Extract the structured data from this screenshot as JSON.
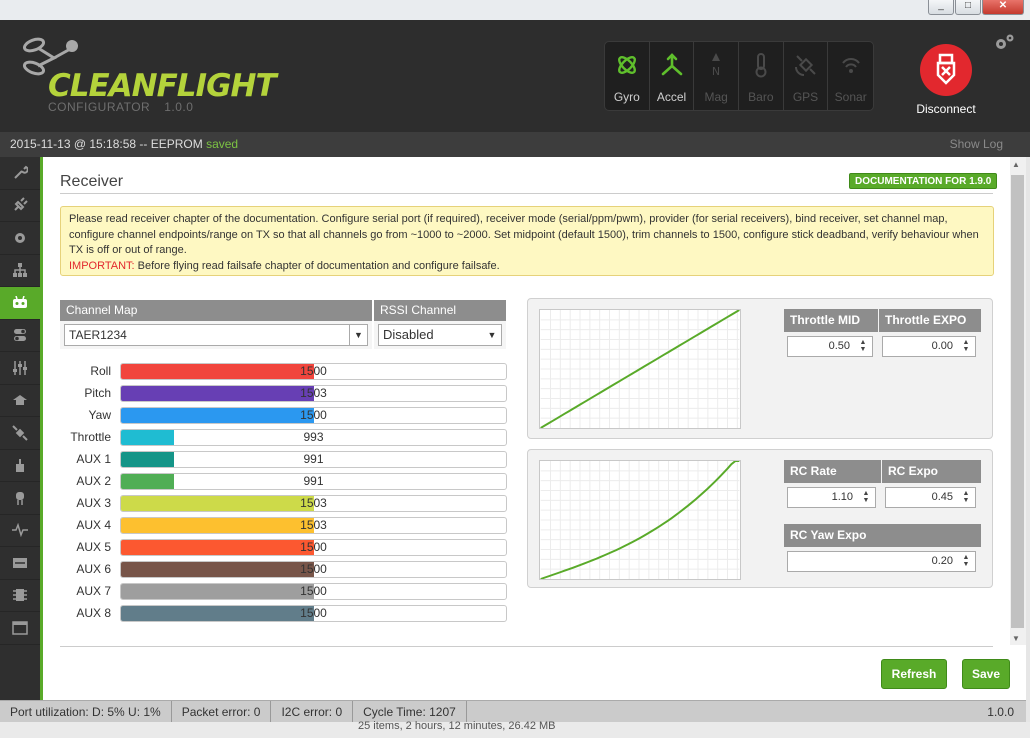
{
  "window": {
    "minimize": "_",
    "maximize": "□",
    "close": "✕"
  },
  "header": {
    "logo_text": "CLEANFLIGHT",
    "logo_sub": "CONFIGURATOR",
    "logo_version": "1.0.0",
    "disconnect_label": "Disconnect"
  },
  "sensors": [
    {
      "label": "Gyro",
      "active": true
    },
    {
      "label": "Accel",
      "active": true
    },
    {
      "label": "Mag",
      "active": false
    },
    {
      "label": "Baro",
      "active": false
    },
    {
      "label": "GPS",
      "active": false
    },
    {
      "label": "Sonar",
      "active": false
    }
  ],
  "log": {
    "prefix": "2015-11-13 @ 15:18:58 -- EEPROM ",
    "saved": "saved",
    "show_log": "Show Log"
  },
  "receiver": {
    "title": "Receiver",
    "doc_button": "DOCUMENTATION FOR 1.9.0",
    "note": "Please read receiver chapter of the documentation. Configure serial port (if required), receiver mode (serial/ppm/pwm), provider (for serial receivers), bind receiver, set channel map, configure channel endpoints/range on TX so that all channels go from ~1000 to ~2000. Set midpoint (default 1500), trim channels to 1500, configure stick deadband, verify behaviour when TX is off or out of range.",
    "note_important_label": "IMPORTANT:",
    "note_important_text": " Before flying read failsafe chapter of documentation and configure failsafe.",
    "channel_map_header": "Channel Map",
    "channel_map_value": "TAER1234",
    "rssi_header": "RSSI Channel",
    "rssi_value": "Disabled",
    "channels": [
      {
        "name": "Roll",
        "value": 1500,
        "color": "#f1453d"
      },
      {
        "name": "Pitch",
        "value": 1503,
        "color": "#673fb4"
      },
      {
        "name": "Yaw",
        "value": 1500,
        "color": "#2b98f0"
      },
      {
        "name": "Throttle",
        "value": 993,
        "color": "#1fbcd2"
      },
      {
        "name": "AUX 1",
        "value": 991,
        "color": "#159588"
      },
      {
        "name": "AUX 2",
        "value": 991,
        "color": "#50ae55"
      },
      {
        "name": "AUX 3",
        "value": 1503,
        "color": "#cdda49"
      },
      {
        "name": "AUX 4",
        "value": 1503,
        "color": "#fdc02f"
      },
      {
        "name": "AUX 5",
        "value": 1500,
        "color": "#fc5830"
      },
      {
        "name": "AUX 6",
        "value": 1500,
        "color": "#785549"
      },
      {
        "name": "AUX 7",
        "value": 1500,
        "color": "#9e9e9e"
      },
      {
        "name": "AUX 8",
        "value": 1500,
        "color": "#617d8a"
      }
    ],
    "throttle_mid_label": "Throttle MID",
    "throttle_mid": "0.50",
    "throttle_expo_label": "Throttle EXPO",
    "throttle_expo": "0.00",
    "rc_rate_label": "RC Rate",
    "rc_rate": "1.10",
    "rc_expo_label": "RC Expo",
    "rc_expo": "0.45",
    "rc_yaw_expo_label": "RC Yaw Expo",
    "rc_yaw_expo": "0.20",
    "refresh_button": "Refresh",
    "save_button": "Save"
  },
  "status": {
    "port": "Port utilization: D: 5% U: 1%",
    "packet": "Packet error: 0",
    "i2c": "I2C error: 0",
    "cycle": "Cycle Time: 1207",
    "version": "1.0.0"
  },
  "below_text": "25 items, 2 hours, 12 minutes, 26.42 MB",
  "colors": {
    "accent": "#59aa29",
    "header": "#2d2d2d",
    "disconnect": "#e2282e"
  }
}
